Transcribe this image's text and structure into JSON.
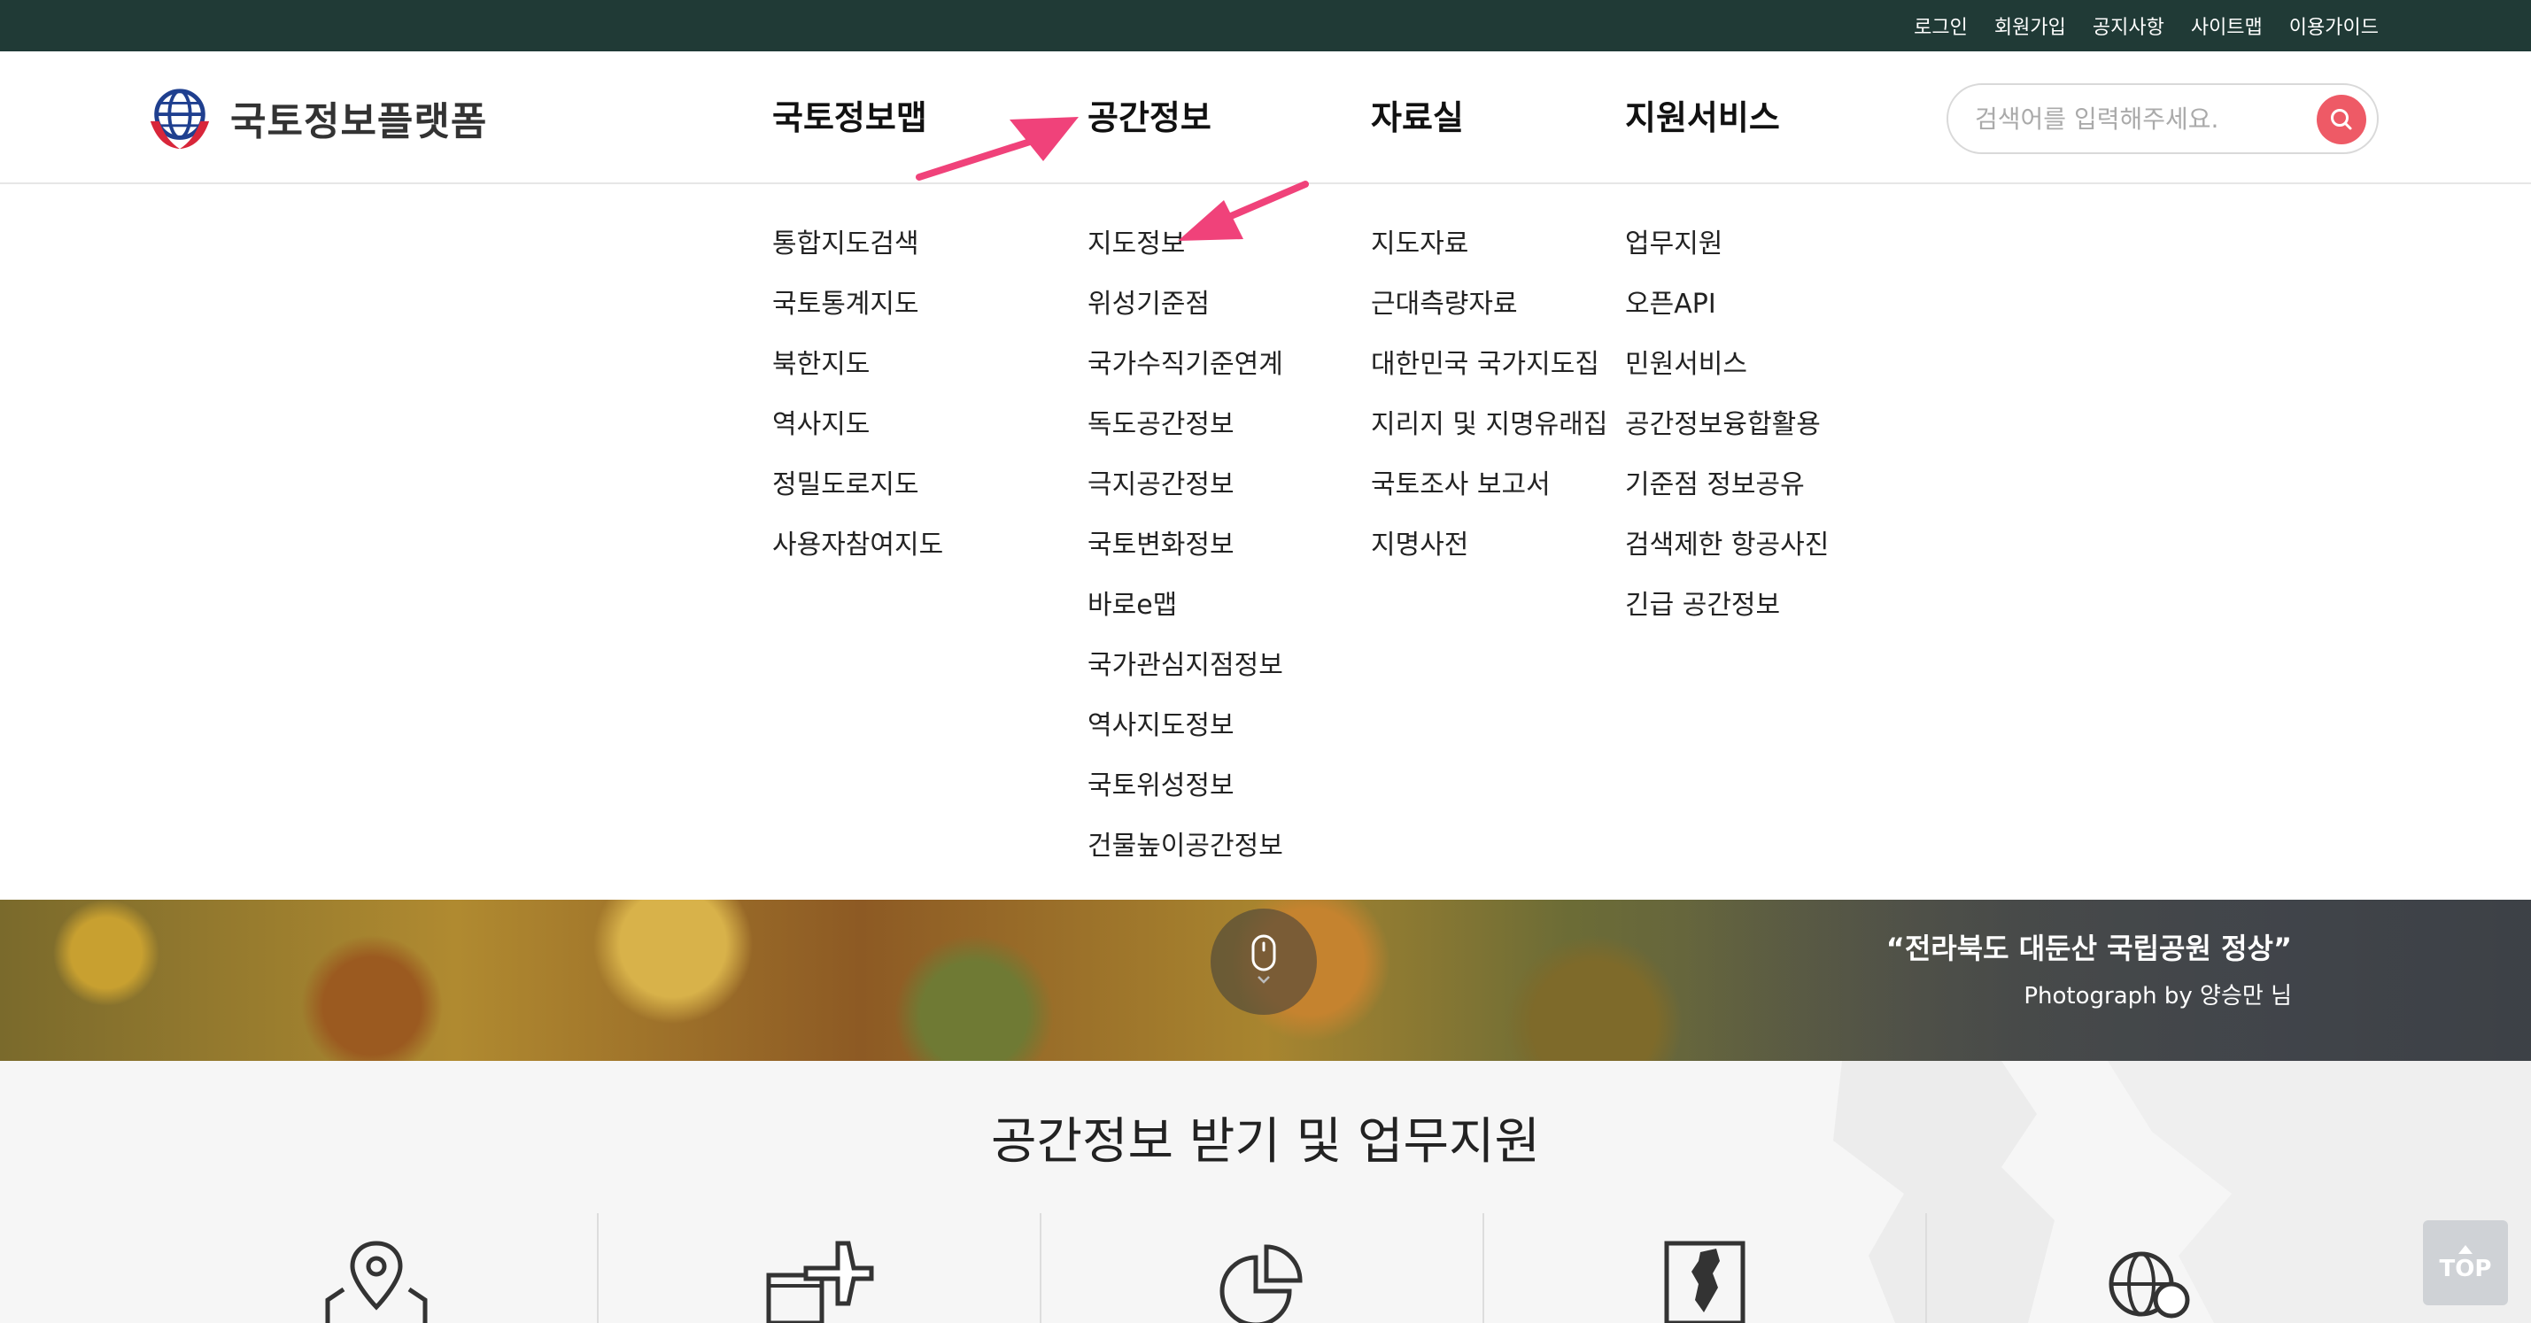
{
  "util_nav": [
    "로그인",
    "회원가입",
    "공지사항",
    "사이트맵",
    "이용가이드"
  ],
  "logo": {
    "text": "국토정보플랫폼"
  },
  "main_nav": [
    "국토정보맵",
    "공간정보",
    "자료실",
    "지원서비스"
  ],
  "search": {
    "placeholder": "검색어를 입력해주세요."
  },
  "menu_columns": [
    [
      "통합지도검색",
      "국토통계지도",
      "북한지도",
      "역사지도",
      "정밀도로지도",
      "사용자참여지도"
    ],
    [
      "지도정보",
      "위성기준점",
      "국가수직기준연계",
      "독도공간정보",
      "극지공간정보",
      "국토변화정보",
      "바로e맵",
      "국가관심지점정보",
      "역사지도정보",
      "국토위성정보",
      "건물높이공간정보"
    ],
    [
      "지도자료",
      "근대측량자료",
      "대한민국 국가지도집",
      "지리지 및 지명유래집",
      "국토조사 보고서",
      "지명사전"
    ],
    [
      "업무지원",
      "오픈API",
      "민원서비스",
      "공간정보융합활용",
      "기준점 정보공유",
      "검색제한 항공사진",
      "긴급 공간정보"
    ]
  ],
  "banner": {
    "caption_title": "“전라북도 대둔산 국립공원 정상”",
    "caption_credit": "Photograph by 양승만 님"
  },
  "section": {
    "title": "공간정보 받기 및 업무지원"
  },
  "top_button": {
    "label": "TOP"
  },
  "colors": {
    "topbar": "#203a36",
    "search_button": "#ee5a66",
    "annotation_arrow": "#f0427a"
  },
  "icons": [
    "globe-logo-icon",
    "search-icon",
    "mouse-scroll-icon",
    "location-map-icon",
    "airplane-icon",
    "pie-chart-icon",
    "korea-map-icon",
    "globe-search-icon",
    "arrow-up-icon"
  ]
}
